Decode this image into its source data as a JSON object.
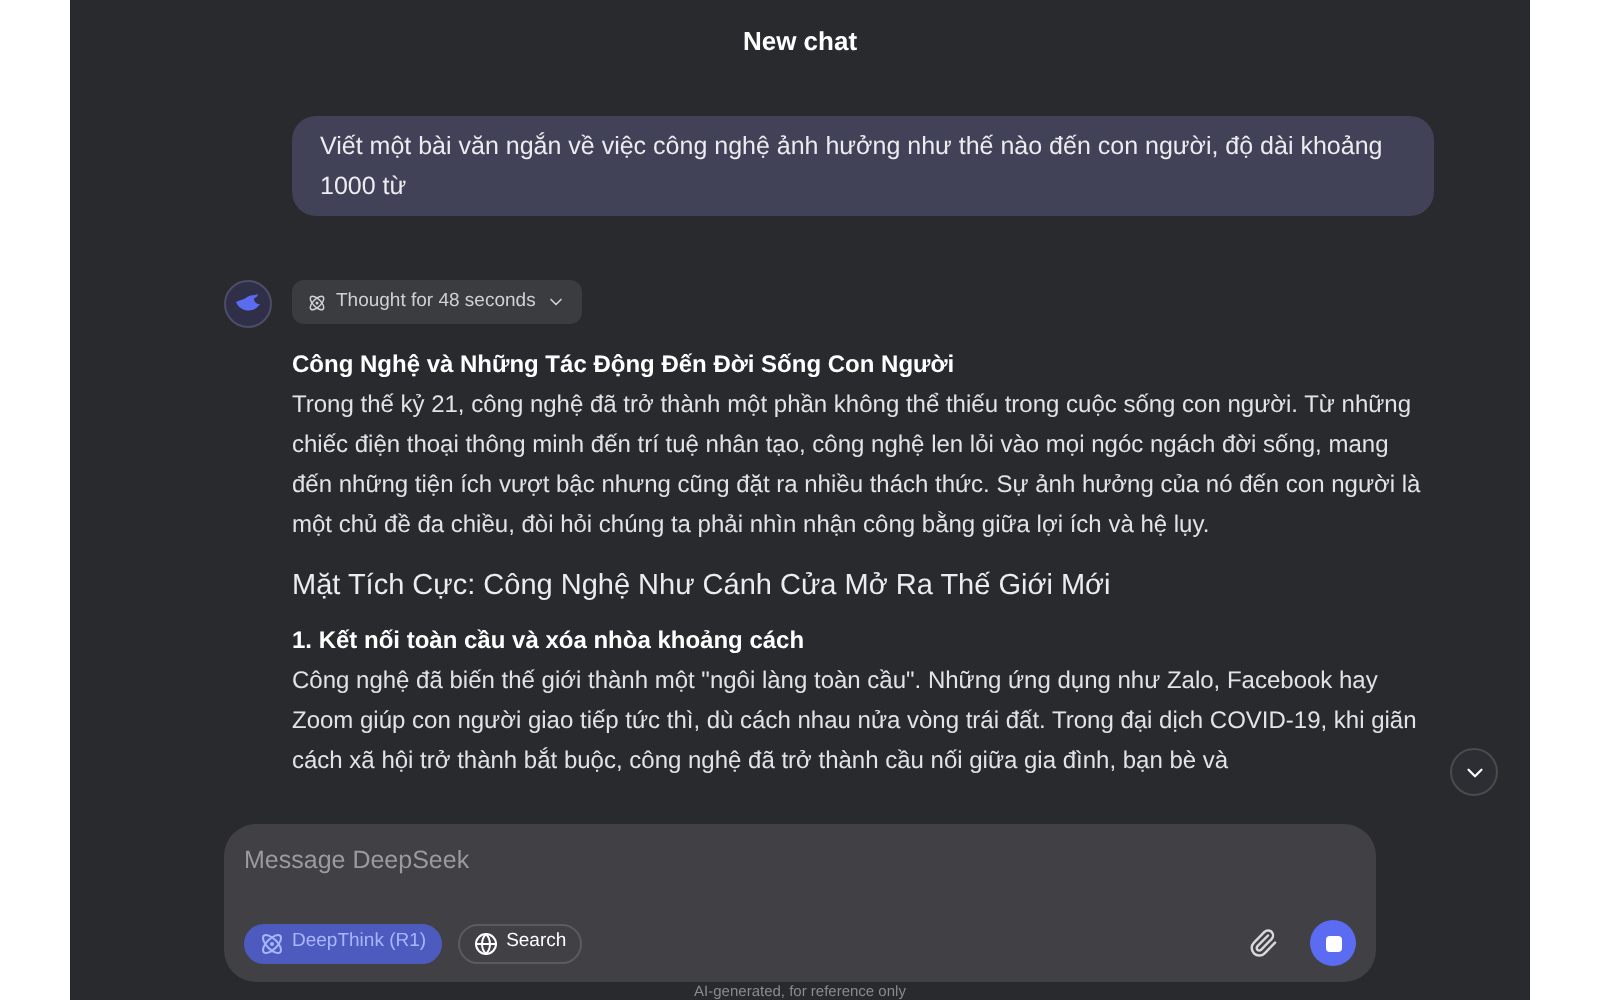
{
  "window": {
    "title": "New chat"
  },
  "user_message": "Viết một bài văn ngắn về việc công nghệ ảnh hưởng như thế nào đến con người, độ dài khoảng 1000 từ",
  "thought": {
    "label": "Thought for 48 seconds",
    "expanded": false
  },
  "answer": [
    {
      "kind": "title",
      "text": "Công Nghệ và Những Tác Động Đến Đời Sống Con Người"
    },
    {
      "kind": "paragraph",
      "text": "Trong thế kỷ 21, công nghệ đã trở thành một phần không thể thiếu trong cuộc sống con người. Từ những chiếc điện thoại thông minh đến trí tuệ nhân tạo, công nghệ len lỏi vào mọi ngóc ngách đời sống, mang đến những tiện ích vượt bậc nhưng cũng đặt ra nhiều thách thức. Sự ảnh hưởng của nó đến con người là một chủ đề đa chiều, đòi hỏi chúng ta phải nhìn nhận công bằng giữa lợi ích và hệ lụy."
    },
    {
      "kind": "heading",
      "text": "Mặt Tích Cực: Công Nghệ Như Cánh Cửa Mở Ra Thế Giới Mới"
    },
    {
      "kind": "subheading",
      "text": "1. Kết nối toàn cầu và xóa nhòa khoảng cách"
    },
    {
      "kind": "paragraph",
      "text": "Công nghệ đã biến thế giới thành một \"ngôi làng toàn cầu\". Những ứng dụng như Zalo, Facebook hay Zoom giúp con người giao tiếp tức thì, dù cách nhau nửa vòng trái đất. Trong đại dịch COVID-19, khi giãn cách xã hội trở thành bắt buộc, công nghệ đã trở thành cầu nối giữa gia đình, bạn bè và"
    }
  ],
  "composer": {
    "placeholder": "Message DeepSeek",
    "toggles": [
      {
        "label": "DeepThink (R1)",
        "selected": true,
        "kind": "think"
      },
      {
        "label": "Search",
        "selected": false,
        "kind": "search"
      }
    ],
    "generating": true
  },
  "footer": "AI-generated, for reference only"
}
